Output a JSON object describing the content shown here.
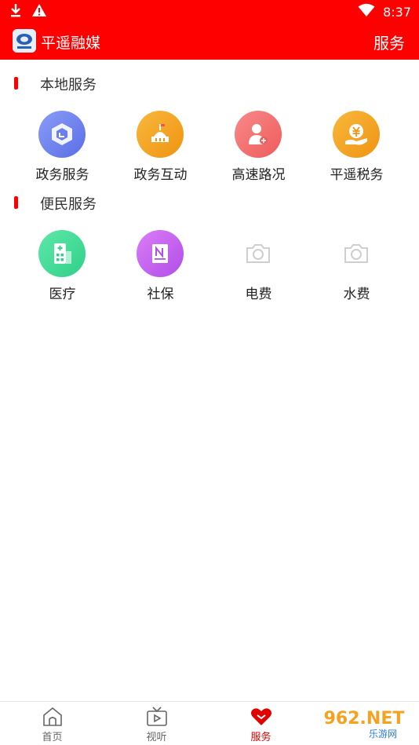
{
  "status": {
    "time": "8:37"
  },
  "header": {
    "title": "平遥融媒",
    "service_label": "服务"
  },
  "sections": [
    {
      "title": "本地服务",
      "items": [
        {
          "label": "政务服务",
          "icon": "government-service-icon",
          "color": "#6b7df0"
        },
        {
          "label": "政务互动",
          "icon": "government-interaction-icon",
          "color": "#f4a21f"
        },
        {
          "label": "高速路况",
          "icon": "highway-status-icon",
          "color": "#f46a6a"
        },
        {
          "label": "平遥税务",
          "icon": "tax-icon",
          "color": "#f4a21f"
        }
      ]
    },
    {
      "title": "便民服务",
      "items": [
        {
          "label": "医疗",
          "icon": "medical-icon",
          "color": "#3ddc97"
        },
        {
          "label": "社保",
          "icon": "social-security-icon",
          "color": "#c45cf0"
        },
        {
          "label": "电费",
          "icon": "camera-placeholder-icon",
          "color": "#cccccc"
        },
        {
          "label": "水费",
          "icon": "camera-placeholder-icon",
          "color": "#cccccc"
        }
      ]
    }
  ],
  "tabs": [
    {
      "label": "首页",
      "icon": "home-icon"
    },
    {
      "label": "视听",
      "icon": "tv-icon"
    },
    {
      "label": "服务",
      "icon": "heart-icon",
      "active": true
    }
  ],
  "watermark": {
    "text": "962.NET",
    "subtext": "乐游网"
  }
}
